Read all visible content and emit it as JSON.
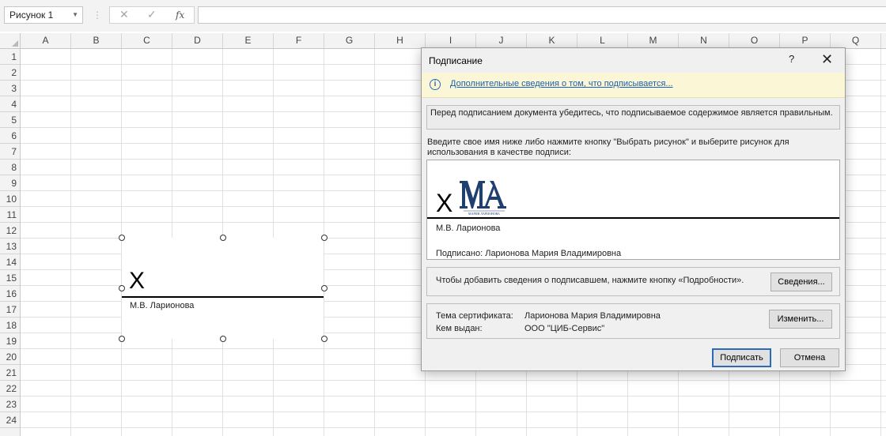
{
  "formula_bar": {
    "name_box": "Рисунок 1",
    "cancel_icon": "✕",
    "enter_icon": "✓",
    "fx_label": "fx",
    "formula_value": ""
  },
  "grid": {
    "columns": [
      "A",
      "B",
      "C",
      "D",
      "E",
      "F",
      "G",
      "H",
      "I",
      "J",
      "K",
      "L",
      "M",
      "N",
      "O",
      "P",
      "Q"
    ],
    "rows": [
      "1",
      "2",
      "3",
      "4",
      "5",
      "6",
      "7",
      "8",
      "9",
      "10",
      "11",
      "12",
      "13",
      "14",
      "15",
      "16",
      "17",
      "18",
      "19",
      "20",
      "21",
      "22",
      "23",
      "24"
    ]
  },
  "sheet_signature": {
    "x_mark": "X",
    "signer_name": "М.В. Ларионова"
  },
  "dialog": {
    "title": "Подписание",
    "help": "?",
    "close": "✕",
    "info_link": "Дополнительные сведения о том, что подписывается...",
    "warning": "Перед подписанием документа убедитесь, что подписываемое содержимое является правильным.",
    "prompt": "Введите свое имя ниже либо нажмите кнопку \"Выбрать рисунок\" и выберите рисунок для использования в качестве подписи:",
    "signature": {
      "x_mark": "X",
      "logo_caption": "МАРИЯ ЛАРИОНОВА",
      "signer_name": "М.В. Ларионова",
      "signed_by": "Подписано: Ларионова Мария Владимировна"
    },
    "details_text": "Чтобы добавить сведения о подписавшем, нажмите кнопку «Подробности».",
    "details_button": "Сведения...",
    "certificate": {
      "subject_label": "Тема сертификата:",
      "subject_value": "Ларионова Мария Владимировна",
      "issuer_label": "Кем выдан:",
      "issuer_value": "ООО \"ЦИБ-Сервис\"",
      "change_button": "Изменить..."
    },
    "sign_button": "Подписать",
    "cancel_button": "Отмена"
  },
  "colors": {
    "accent": "#2a6ab8",
    "info_bar": "#fbf7d6",
    "logo_navy": "#1f3f6e"
  }
}
